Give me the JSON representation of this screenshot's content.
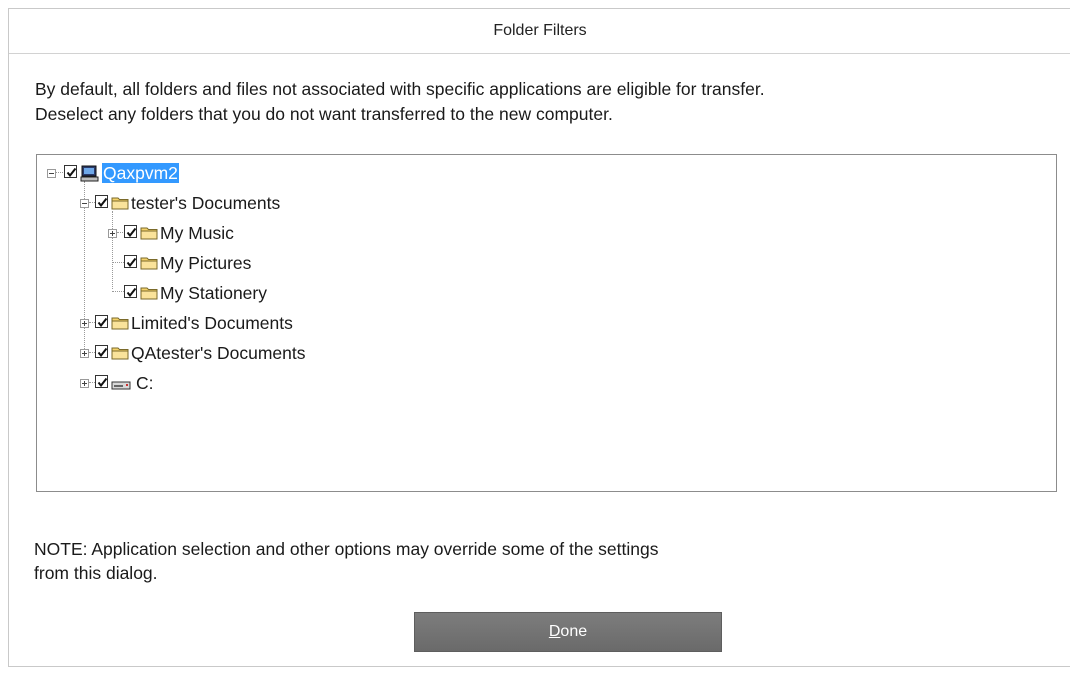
{
  "dialog": {
    "title": "Folder Filters",
    "description_line1": "By default, all folders and files not associated with specific applications are eligible for transfer.",
    "description_line2": "Deselect any folders that you do not want transferred to the new computer.",
    "note_line1": "NOTE:  Application selection and other options may override some of the settings",
    "note_line2": "from this dialog.",
    "done_button": {
      "mnemonic": "D",
      "rest": "one"
    }
  },
  "tree": {
    "nodes": [
      {
        "label": "Qaxpvm2",
        "checked": true,
        "icon": "computer-icon",
        "expander": "minus",
        "selected": true
      },
      {
        "label": "tester's Documents",
        "checked": true,
        "icon": "folder-icon",
        "expander": "minus"
      },
      {
        "label": "My Music",
        "checked": true,
        "icon": "folder-icon",
        "expander": "plus"
      },
      {
        "label": "My Pictures",
        "checked": true,
        "icon": "folder-icon",
        "expander": "none"
      },
      {
        "label": "My Stationery",
        "checked": true,
        "icon": "folder-icon",
        "expander": "none"
      },
      {
        "label": "Limited's Documents",
        "checked": true,
        "icon": "folder-icon",
        "expander": "plus"
      },
      {
        "label": "QAtester's Documents",
        "checked": true,
        "icon": "folder-icon",
        "expander": "plus"
      },
      {
        "label": "C:",
        "checked": true,
        "icon": "drive-icon",
        "expander": "plus"
      }
    ]
  },
  "colors": {
    "selection": "#3399ff",
    "button": "#737373",
    "folder": "#f5d36b"
  }
}
